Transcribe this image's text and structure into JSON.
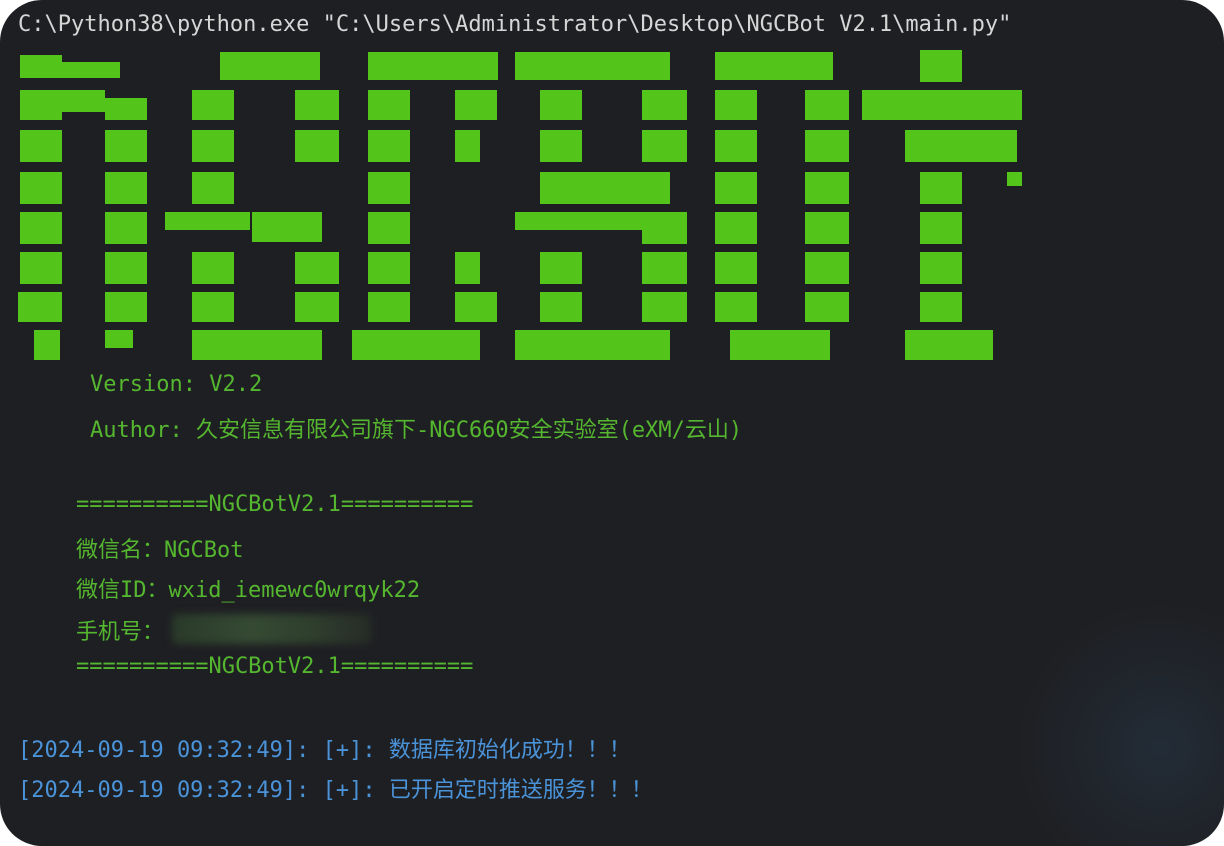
{
  "command_line": "C:\\Python38\\python.exe \"C:\\Users\\Administrator\\Desktop\\NGCBot V2.1\\main.py\"",
  "banner": {
    "text": "NGCBOT",
    "color": "#52c41a"
  },
  "version_line": "Version: V2.2",
  "author_line": "Author: 久安信息有限公司旗下-NGC660安全实验室(eXM/云山)",
  "info_block": {
    "separator_top": "==========NGCBotV2.1==========",
    "wechat_name": "微信名：NGCBot",
    "wechat_id": "微信ID：wxid_iemewc0wrqyk22",
    "phone_label": "手机号：",
    "separator_bottom": "==========NGCBotV2.1=========="
  },
  "log_lines": [
    "[2024-09-19 09:32:49]: [+]: 数据库初始化成功！！！",
    "[2024-09-19 09:32:49]: [+]: 已开启定时推送服务！！！"
  ],
  "colors": {
    "background": "#1e1f22",
    "green_text": "#55b72f",
    "log_blue": "#4b93d9",
    "command_text": "#d6d6d6"
  }
}
